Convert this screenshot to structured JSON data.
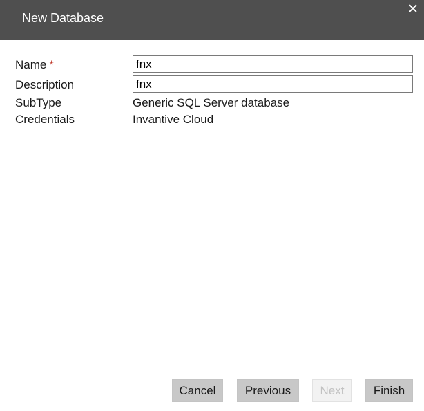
{
  "dialog": {
    "title": "New Database",
    "close_glyph": "✕"
  },
  "form": {
    "name": {
      "label": "Name",
      "required_marker": "*",
      "value": "fnx"
    },
    "description": {
      "label": "Description",
      "value": "fnx"
    },
    "subtype": {
      "label": "SubType",
      "value": "Generic SQL Server database"
    },
    "credentials": {
      "label": "Credentials",
      "value": "Invantive Cloud"
    }
  },
  "buttons": {
    "cancel": "Cancel",
    "previous": "Previous",
    "next": "Next",
    "finish": "Finish"
  },
  "colors": {
    "titlebar": "#4f4f4f",
    "required": "#c0392b",
    "button": "#c8c8c8",
    "button_disabled": "#f2f2f2"
  }
}
